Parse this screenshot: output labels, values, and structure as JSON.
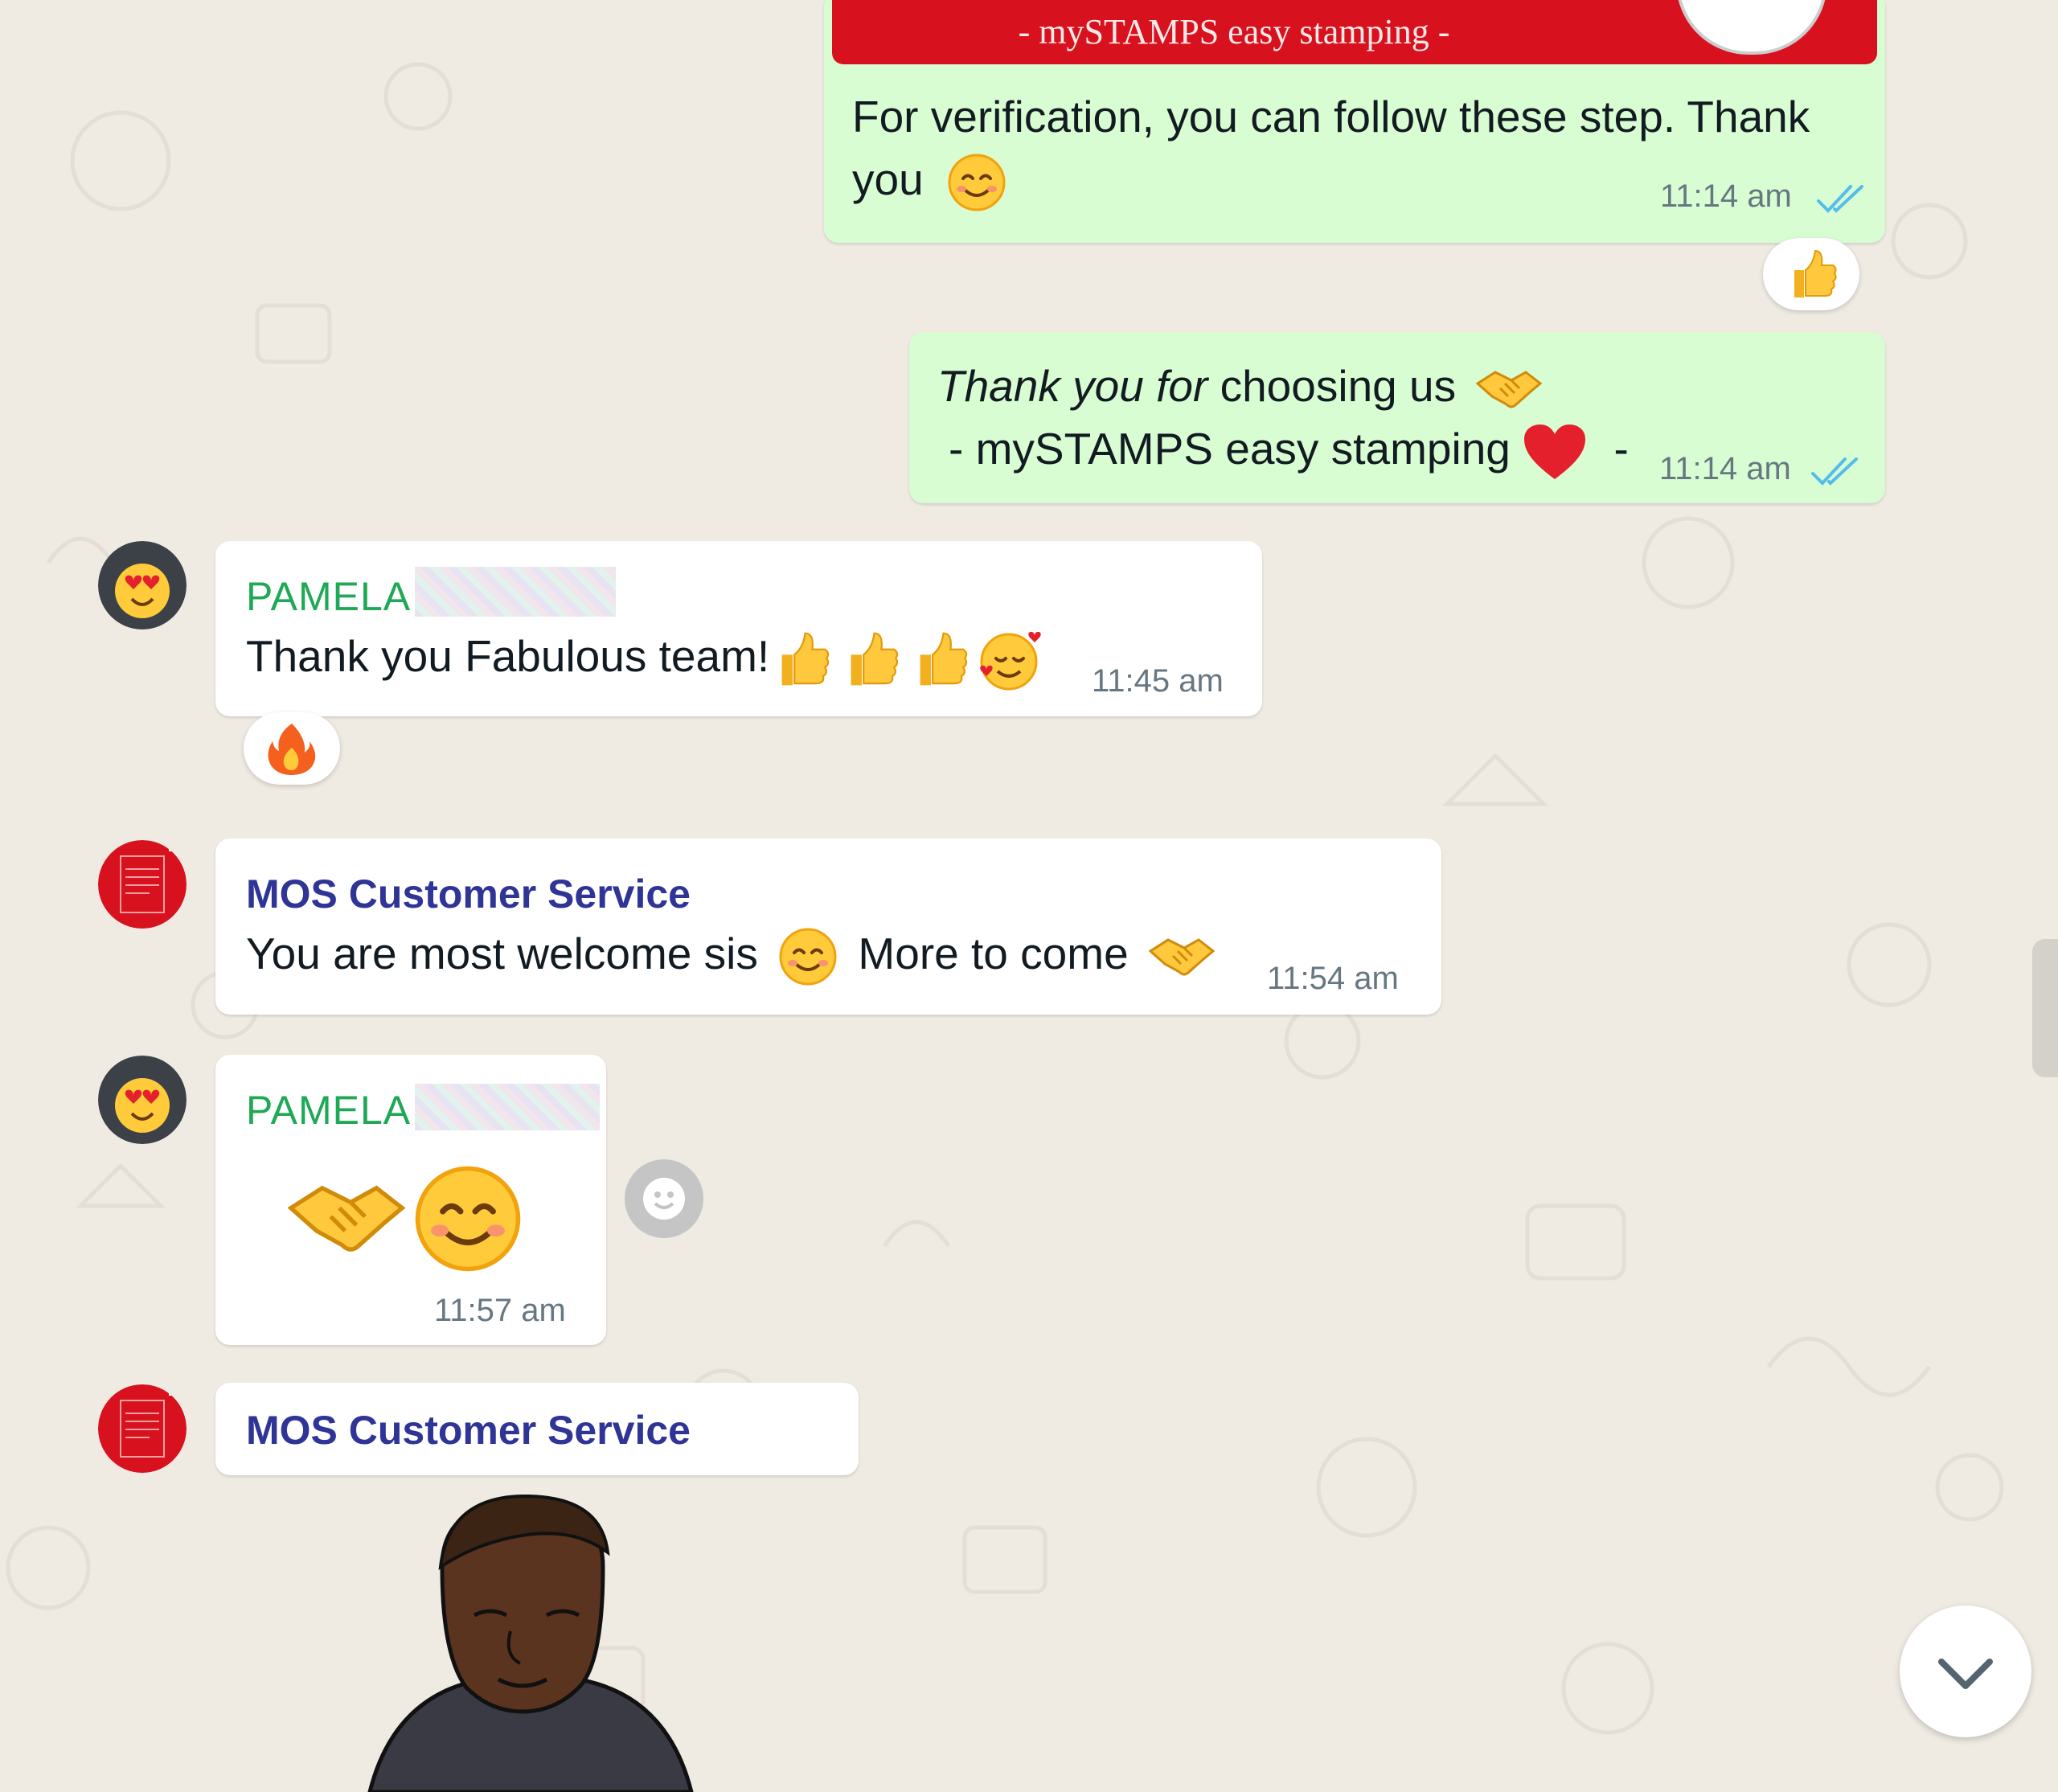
{
  "messages": [
    {
      "banner_text": "- mySTAMPS easy stamping -",
      "text_line1": "For verification, you can follow these step. Thank",
      "text_line2": "you",
      "time": "11:14 am",
      "reaction": "thumbs-up"
    },
    {
      "text_italic": "Thank you for",
      "text_line1_rest": "choosing us",
      "text_line2": "- mySTAMPS easy stamping",
      "text_line2_end": "-",
      "time": "11:14 am"
    },
    {
      "sender": "PAMELA",
      "text": "Thank you Fabulous team!",
      "time": "11:45 am",
      "reaction": "fire"
    },
    {
      "sender": "MOS Customer Service",
      "text_part1": "You are most welcome sis",
      "text_part2": "More to come",
      "time": "11:54 am"
    },
    {
      "sender": "PAMELA",
      "time": "11:57 am"
    },
    {
      "sender": "MOS Customer Service"
    }
  ],
  "colors": {
    "outgoing_bubble": "#d9fdd3",
    "incoming_bubble": "#ffffff",
    "pamela_name": "#1fa855",
    "mos_name": "#2f3497",
    "read_tick": "#53bdeb",
    "banner_red": "#d7121e"
  }
}
